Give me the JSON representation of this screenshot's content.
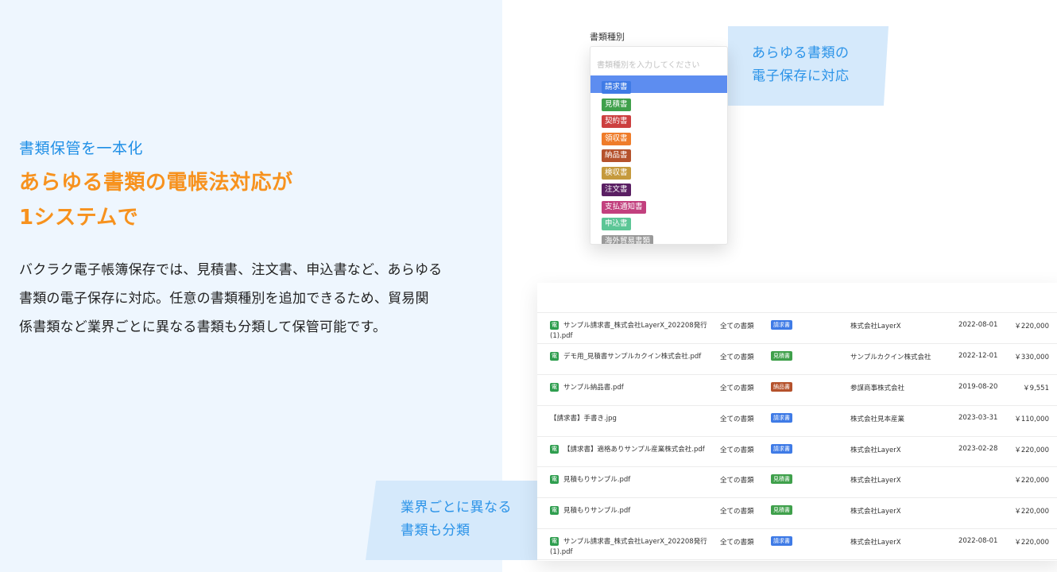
{
  "left": {
    "eyebrow": "書類保管を一本化",
    "headline_line1": "あらゆる書類の電帳法対応が",
    "headline_line2": "1システムで",
    "body_line1": "バクラク電子帳簿保存では、見積書、注文書、申込書など、あらゆる",
    "body_line2": "書類の電子保存に対応。任意の書類種別を追加できるため、貿易関",
    "body_line3": "係書類など業界ごとに異なる書類も分類して保管可能です。"
  },
  "dropdown": {
    "label": "書類種別",
    "placeholder": "書類種別を入力してください",
    "options": [
      {
        "label": "請求書",
        "color": "#3f7be6"
      },
      {
        "label": "見積書",
        "color": "#3fa04b"
      },
      {
        "label": "契約書",
        "color": "#cc3f3f"
      },
      {
        "label": "領収書",
        "color": "#ef7c2a"
      },
      {
        "label": "納品書",
        "color": "#b5522c"
      },
      {
        "label": "検収書",
        "color": "#c59a3d"
      },
      {
        "label": "注文書",
        "color": "#5a1f63"
      },
      {
        "label": "支払通知書",
        "color": "#c2407e"
      },
      {
        "label": "申込書",
        "color": "#5cc696"
      },
      {
        "label": "海外貿易書類",
        "color": "#9a9a9a"
      }
    ]
  },
  "callouts": {
    "top_line1": "あらゆる書類の",
    "top_line2": "電子保存に対応",
    "bottom_line1": "業界ごとに異なる",
    "bottom_line2": "書類も分類"
  },
  "doc_icon_label": "電",
  "table": {
    "rows": [
      {
        "file": "サンプル請求書_株式会社LayerX_202208発行(1).pdf",
        "scope": "全ての書類",
        "type": "請求書",
        "type_color": "#3f7be6",
        "vendor": "株式会社LayerX",
        "date": "2022-08-01",
        "amount": "￥220,000",
        "icon": true
      },
      {
        "file": "デモ用_見積書サンプルカクイン株式会社.pdf",
        "scope": "全ての書類",
        "type": "見積書",
        "type_color": "#3fa04b",
        "vendor": "サンプルカクイン株式会社",
        "date": "2022-12-01",
        "amount": "￥330,000",
        "icon": true
      },
      {
        "file": "サンプル納品書.pdf",
        "scope": "全ての書類",
        "type": "納品書",
        "type_color": "#b5522c",
        "vendor": "参謀商事株式会社",
        "date": "2019-08-20",
        "amount": "￥9,551",
        "icon": true
      },
      {
        "file": "【請求書】手書き.jpg",
        "scope": "全ての書類",
        "type": "請求書",
        "type_color": "#3f7be6",
        "vendor": "株式会社見本産業",
        "date": "2023-03-31",
        "amount": "￥110,000",
        "icon": false
      },
      {
        "file": "【請求書】適格ありサンプル産業株式会社.pdf",
        "scope": "全ての書類",
        "type": "請求書",
        "type_color": "#3f7be6",
        "vendor": "株式会社LayerX",
        "date": "2023-02-28",
        "amount": "￥220,000",
        "icon": true
      },
      {
        "file": "見積もりサンプル.pdf",
        "scope": "全ての書類",
        "type": "見積書",
        "type_color": "#3fa04b",
        "vendor": "株式会社LayerX",
        "date": "",
        "amount": "￥220,000",
        "icon": true
      },
      {
        "file": "見積もりサンプル.pdf",
        "scope": "全ての書類",
        "type": "見積書",
        "type_color": "#3fa04b",
        "vendor": "株式会社LayerX",
        "date": "",
        "amount": "￥220,000",
        "icon": true
      },
      {
        "file": "サンプル請求書_株式会社LayerX_202208発行(1).pdf",
        "scope": "全ての書類",
        "type": "請求書",
        "type_color": "#3f7be6",
        "vendor": "株式会社LayerX",
        "date": "2022-08-01",
        "amount": "￥220,000",
        "icon": true
      }
    ]
  }
}
